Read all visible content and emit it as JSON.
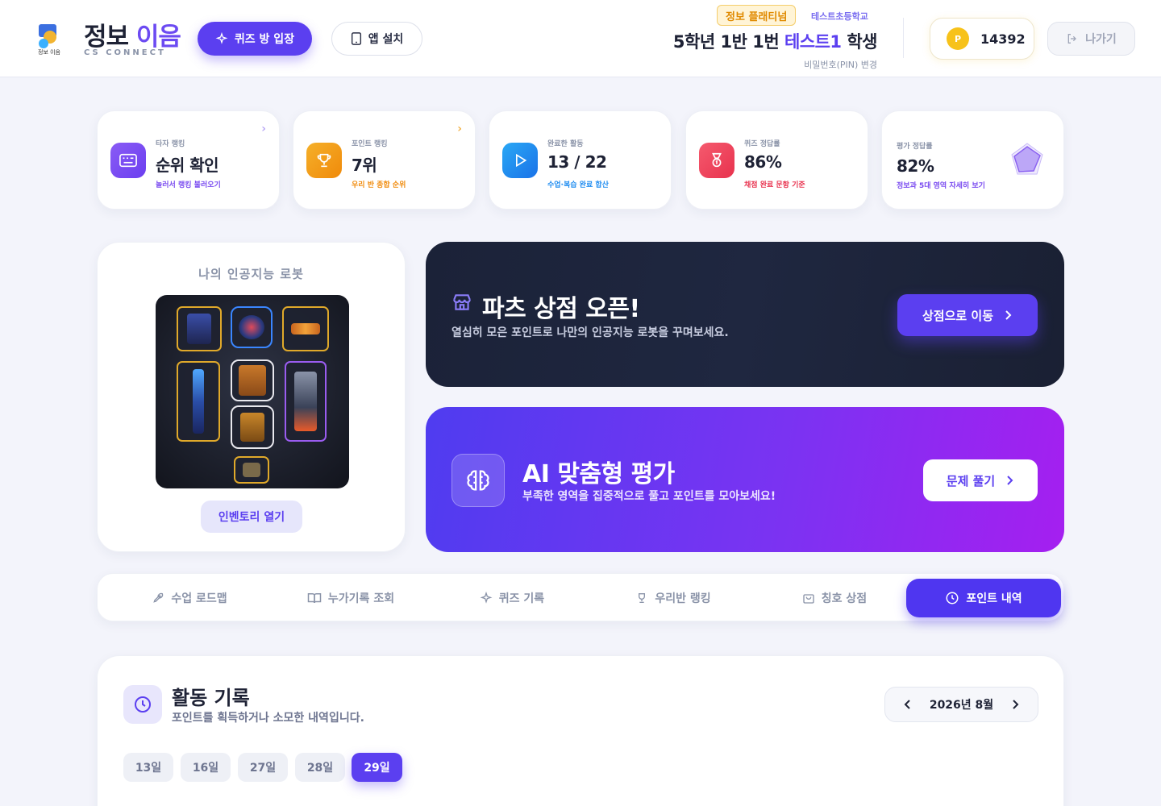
{
  "header": {
    "logo_text": "정보 이음",
    "brand_title_a": "정보",
    "brand_title_b": "이음",
    "brand_sub": "CS CONNECT",
    "quiz_button": "퀴즈 방 입장",
    "app_button": "앱 설치",
    "tier_badge": "정보 플래티넘",
    "school": "테스트초등학교",
    "student_prefix": "5학년 1반 1번",
    "student_name": "테스트1",
    "student_suffix": "학생",
    "pin_change": "비밀번호(PIN) 변경",
    "points_icon": "P",
    "points": "14392",
    "logout_button": "나가기"
  },
  "stats": [
    {
      "label": "타자 랭킹",
      "value": "순위 확인",
      "sub": "놀러서 랭킹 불러오기",
      "icon": "keyboard-icon",
      "color": "#7a4bf0"
    },
    {
      "label": "포인트 랭킹",
      "value": "7위",
      "sub": "우리 반 종합 순위",
      "icon": "trophy-icon",
      "color": "#f29a0f"
    },
    {
      "label": "완료한 활동",
      "value": "13 / 22",
      "sub": "수업·복습 완료 합산",
      "icon": "play-icon",
      "color": "#1f8cf0"
    },
    {
      "label": "퀴즈 정답률",
      "value": "86%",
      "sub": "채점 완료 문항 기준",
      "icon": "medal-icon",
      "color": "#f0455f"
    },
    {
      "label": "평가 정답률",
      "value": "82%",
      "sub": "정보과 5대 영역 자세히 보기",
      "icon": "radar-icon",
      "color": "#7a4bf0"
    }
  ],
  "robot": {
    "title": "나의 인공지능 로봇",
    "inventory_button": "인벤토리 열기"
  },
  "shop_banner": {
    "title": "파츠 상점 오픈!",
    "desc": "열심히 모은 포인트로 나만의 인공지능 로봇을 꾸며보세요.",
    "button": "상점으로 이동"
  },
  "ai_banner": {
    "title": "AI 맞춤형 평가",
    "desc": "부족한 영역을 집중적으로 풀고 포인트를 모아보세요!",
    "button": "문제 풀기"
  },
  "tabs": [
    {
      "label": "수업 로드맵",
      "icon": "rocket-icon"
    },
    {
      "label": "누가기록 조회",
      "icon": "book-icon"
    },
    {
      "label": "퀴즈 기록",
      "icon": "sparkle-icon"
    },
    {
      "label": "우리반 랭킹",
      "icon": "trophy-icon"
    },
    {
      "label": "칭호 상점",
      "icon": "bag-icon"
    },
    {
      "label": "포인트 내역",
      "icon": "clock-icon",
      "active": true
    }
  ],
  "activity": {
    "title": "활동 기록",
    "desc": "포인트를 획득하거나 소모한 내역입니다.",
    "month": "2026년 8월",
    "days": [
      "13일",
      "16일",
      "27일",
      "28일",
      "29일"
    ],
    "active_day": "29일"
  }
}
